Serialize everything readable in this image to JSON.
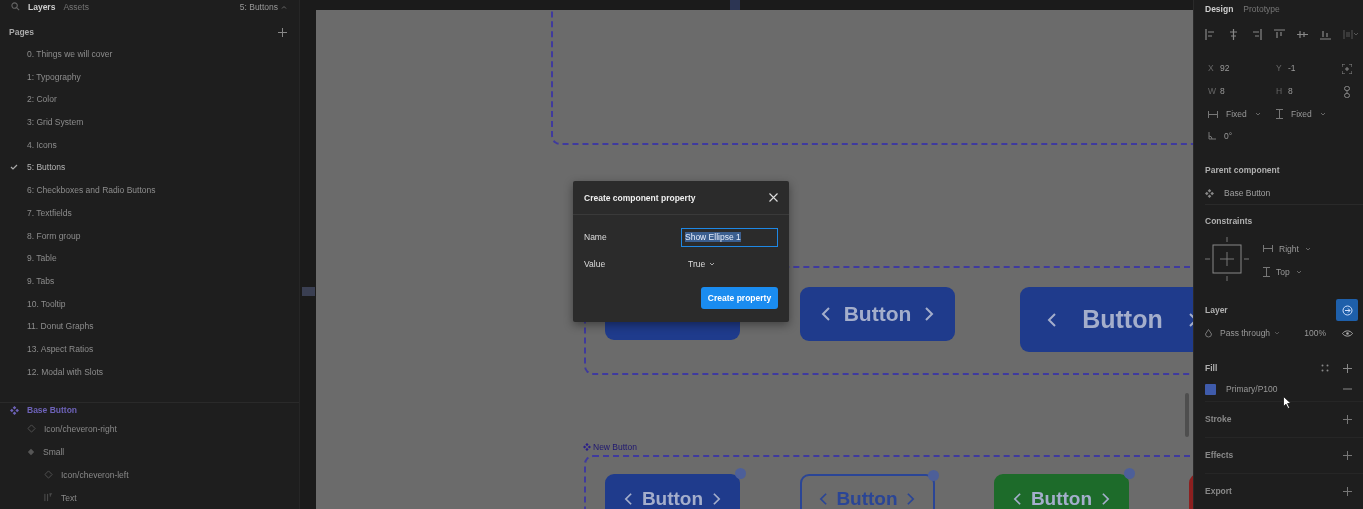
{
  "left_panel": {
    "tabs": [
      {
        "label": "Layers",
        "selected": true
      },
      {
        "label": "Assets",
        "selected": false
      }
    ],
    "page_menu": "5: Buttons",
    "pages_heading": "Pages",
    "pages": [
      {
        "label": "0. Things we will cover",
        "selected": false
      },
      {
        "label": "1: Typography",
        "selected": false
      },
      {
        "label": "2: Color",
        "selected": false
      },
      {
        "label": "3: Grid System",
        "selected": false
      },
      {
        "label": "4. Icons",
        "selected": false
      },
      {
        "label": "5: Buttons",
        "selected": true
      },
      {
        "label": "6: Checkboxes and Radio Buttons",
        "selected": false
      },
      {
        "label": "7. Textfields",
        "selected": false
      },
      {
        "label": "8. Form group",
        "selected": false
      },
      {
        "label": "9. Table",
        "selected": false
      },
      {
        "label": "9. Tabs",
        "selected": false
      },
      {
        "label": "10. Tooltip",
        "selected": false
      },
      {
        "label": "11. Donut Graphs",
        "selected": false
      },
      {
        "label": "13. Aspect Ratios",
        "selected": false
      },
      {
        "label": "12. Modal with Slots",
        "selected": false
      }
    ],
    "layers": [
      {
        "label": "Base Button",
        "kind": "component",
        "children": [
          {
            "label": "Icon/cheveron-right",
            "kind": "instance"
          },
          {
            "label": "Small",
            "kind": "variant",
            "children": [
              {
                "label": "Icon/cheveron-left",
                "kind": "instance"
              },
              {
                "label": "Text",
                "kind": "text"
              }
            ]
          }
        ]
      }
    ]
  },
  "canvas": {
    "size_variants": [
      {
        "kind": "filled"
      },
      {
        "kind": "filled",
        "label": "Button"
      },
      {
        "kind": "filled",
        "label": "Button"
      }
    ],
    "new_button": {
      "title": "New Button",
      "variants": [
        {
          "kind": "filled",
          "color": "#1f3b8c",
          "label": "Button"
        },
        {
          "kind": "outline",
          "color": "#2a4596",
          "label": "Button"
        },
        {
          "kind": "filled",
          "color": "#1d6b2a",
          "label": "Button"
        },
        {
          "kind": "filled",
          "color": "#8c1f1f"
        }
      ]
    }
  },
  "modal": {
    "title": "Create component property",
    "name_label": "Name",
    "name_value": "Show Ellipse 1",
    "value_label": "Value",
    "value": "True",
    "submit": "Create property"
  },
  "design_panel": {
    "tabs": [
      {
        "label": "Design",
        "selected": true
      },
      {
        "label": "Prototype",
        "selected": false
      }
    ],
    "fields": [
      {
        "label": "X",
        "value": "92"
      },
      {
        "label": "Y",
        "value": "-1"
      },
      {
        "label": "W",
        "value": "8"
      },
      {
        "label": "H",
        "value": "8"
      }
    ],
    "horizontal_sizing": "Fixed",
    "vertical_sizing": "Fixed",
    "rotation": "0°",
    "parent_component": {
      "heading": "Parent component",
      "name": "Base Button"
    },
    "constraints": {
      "heading": "Constraints",
      "horizontal": "Right",
      "vertical": "Top"
    },
    "layer": {
      "heading": "Layer",
      "blend_mode": "Pass through",
      "opacity": "100%"
    },
    "fill": {
      "heading": "Fill",
      "items": [
        {
          "name": "Primary/P100",
          "color": "#3f5bab"
        }
      ]
    },
    "stroke": {
      "heading": "Stroke"
    },
    "effects": {
      "heading": "Effects"
    },
    "export": {
      "heading": "Export"
    }
  }
}
